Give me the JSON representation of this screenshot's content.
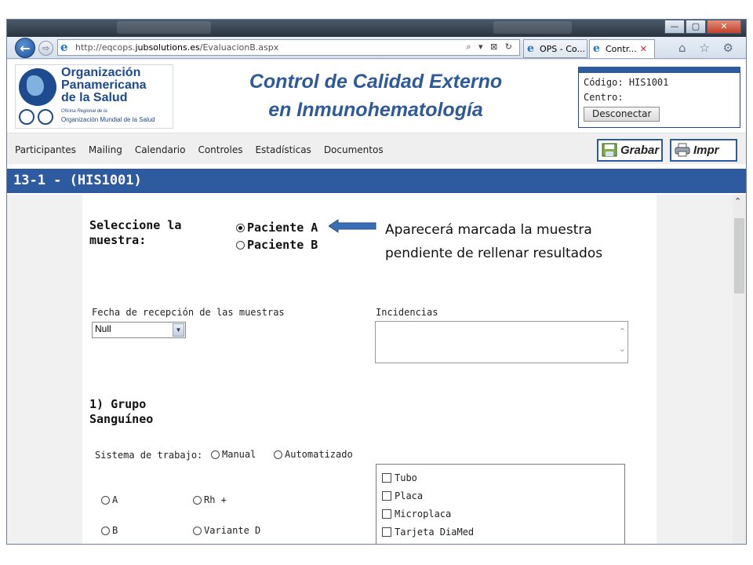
{
  "browser": {
    "url_prefix": "http://eqcops.",
    "url_domain": "jubsolutions.es",
    "url_path": "/EvaluacionB.aspx",
    "address_tools": "⌕ ▾ ⊠ ↻",
    "tabs": [
      {
        "label": "OPS - Co...",
        "active": false
      },
      {
        "label": "Contr...",
        "active": true,
        "close": "✕"
      }
    ],
    "right_icons": "⌂ ☆ ⚙",
    "window_buttons": {
      "minimize": "—",
      "maximize": "▢",
      "close": "✕"
    }
  },
  "header": {
    "logo_lines": [
      "Organización",
      "Panamericana",
      "de la Salud"
    ],
    "logo_sub1": "Oficina Regional de la",
    "logo_sub2": "Organización Mundial de la Salud",
    "title_line1": "Control de Calidad Externo",
    "title_line2": "en Inmunohematología",
    "codigo_label": "Código:",
    "codigo_value": "HIS1001",
    "centro_label": "Centro:",
    "disconnect_label": "Desconectar"
  },
  "menu": {
    "items": [
      "Participantes",
      "Mailing",
      "Calendario",
      "Controles",
      "Estadísticas",
      "Documentos"
    ],
    "save_label": "Grabar",
    "print_label": "Impr"
  },
  "section": {
    "title": "13-1 - (HIS1001)"
  },
  "form": {
    "select_sample_label_1": "Seleccione la",
    "select_sample_label_2": "muestra:",
    "samples": [
      {
        "label": "Paciente A",
        "selected": true
      },
      {
        "label": "Paciente B",
        "selected": false
      }
    ],
    "annotation_line1": "Aparecerá marcada la muestra",
    "annotation_line2": "pendiente de rellenar resultados",
    "fecha_label": "Fecha de recepción de las muestras",
    "fecha_value": "Null",
    "incidencias_label": "Incidencias",
    "grupo_title_1": "1) Grupo",
    "grupo_title_2": "Sanguíneo",
    "sistema_label": "Sistema de trabajo:",
    "sistema_options": [
      "Manual",
      "Automatizado"
    ],
    "group_options": [
      "A",
      "Rh +",
      "B",
      "Variante D"
    ],
    "methods": [
      "Tubo",
      "Placa",
      "Microplaca",
      "Tarjeta DiaMed"
    ]
  },
  "colors": {
    "brand_blue": "#2e5aa0",
    "arrow_blue": "#3a6fb5"
  }
}
